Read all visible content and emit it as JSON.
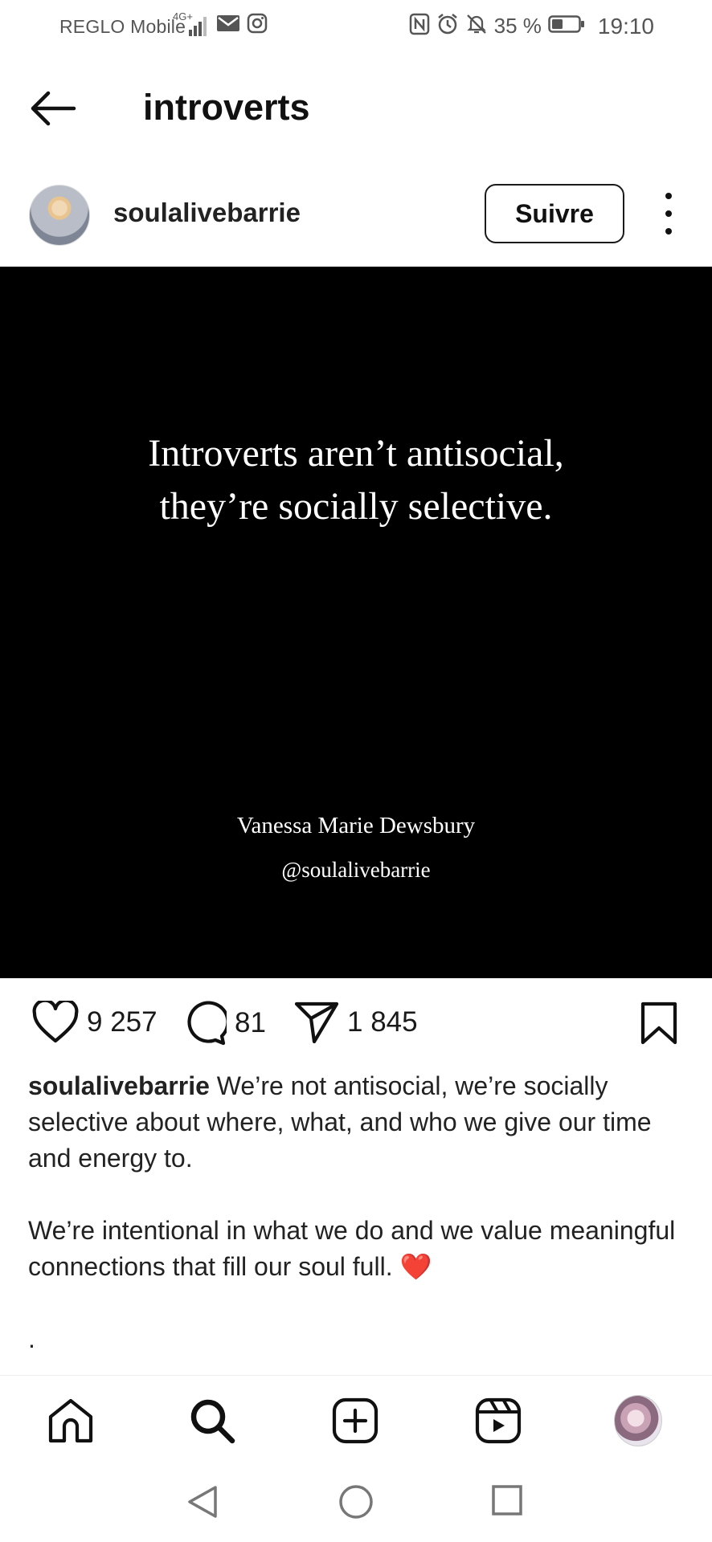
{
  "status_bar": {
    "carrier": "REGLO Mobile",
    "network": "4G+",
    "battery": "35 %",
    "time": "19:10"
  },
  "header": {
    "title": "introverts"
  },
  "post": {
    "username": "soulalivebarrie",
    "follow_label": "Suivre",
    "image": {
      "quote_line1": "Introverts aren’t antisocial,",
      "quote_line2": "they’re socially selective.",
      "author": "Vanessa Marie Dewsbury",
      "handle": "@soulalivebarrie"
    },
    "likes": "9 257",
    "comments": "81",
    "shares": "1 845",
    "caption": {
      "username": "soulalivebarrie",
      "text1": "We’re not antisocial, we’re socially selective about where, what, and who we give our time and energy to.",
      "text2": "We’re intentional in what we do and we value meaningful connections that fill our soul full.",
      "emoji": "❤️",
      "text3": "."
    }
  },
  "bottom_nav": {
    "items": [
      "home-icon",
      "search-icon",
      "create-icon",
      "reels-icon",
      "profile-avatar"
    ]
  },
  "system_nav": {
    "items": [
      "back",
      "home",
      "recents"
    ]
  }
}
